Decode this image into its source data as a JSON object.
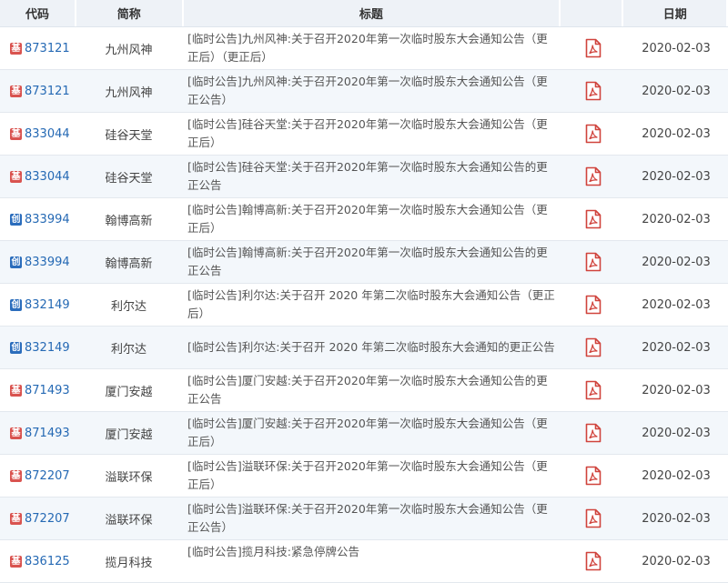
{
  "header": {
    "code": "代码",
    "name": "简称",
    "title": "标题",
    "pdf": "",
    "date": "日期"
  },
  "colors": {
    "badge_ji": "#d9534f",
    "badge_chuang": "#2b6dbc",
    "link": "#2569b4",
    "pdf_red": "#d0433c"
  },
  "pdf_icon": "pdf-file-icon",
  "rows": [
    {
      "badge": "基",
      "badge_type": "ji",
      "code": "873121",
      "name": "九州风神",
      "title": "[临时公告]九州风神:关于召开2020年第一次临时股东大会通知公告（更正后）（更正后）",
      "date": "2020-02-03"
    },
    {
      "badge": "基",
      "badge_type": "ji",
      "code": "873121",
      "name": "九州风神",
      "title": "[临时公告]九州风神:关于召开2020年第一次临时股东大会通知公告（更正公告）",
      "date": "2020-02-03"
    },
    {
      "badge": "基",
      "badge_type": "ji",
      "code": "833044",
      "name": "硅谷天堂",
      "title": "[临时公告]硅谷天堂:关于召开2020年第一次临时股东大会通知公告（更正后）",
      "date": "2020-02-03"
    },
    {
      "badge": "基",
      "badge_type": "ji",
      "code": "833044",
      "name": "硅谷天堂",
      "title": "[临时公告]硅谷天堂:关于召开2020年第一次临时股东大会通知公告的更正公告",
      "date": "2020-02-03"
    },
    {
      "badge": "创",
      "badge_type": "chuang",
      "code": "833994",
      "name": "翰博高新",
      "title": "[临时公告]翰博高新:关于召开2020年第一次临时股东大会通知公告（更正后）",
      "date": "2020-02-03"
    },
    {
      "badge": "创",
      "badge_type": "chuang",
      "code": "833994",
      "name": "翰博高新",
      "title": "[临时公告]翰博高新:关于召开2020年第一次临时股东大会通知公告的更正公告",
      "date": "2020-02-03"
    },
    {
      "badge": "创",
      "badge_type": "chuang",
      "code": "832149",
      "name": "利尔达",
      "title": "[临时公告]利尔达:关于召开 2020 年第二次临时股东大会通知公告（更正后）",
      "date": "2020-02-03"
    },
    {
      "badge": "创",
      "badge_type": "chuang",
      "code": "832149",
      "name": "利尔达",
      "title": "[临时公告]利尔达:关于召开 2020 年第二次临时股东大会通知的更正公告",
      "date": "2020-02-03"
    },
    {
      "badge": "基",
      "badge_type": "ji",
      "code": "871493",
      "name": "厦门安越",
      "title": "[临时公告]厦门安越:关于召开2020年第一次临时股东大会通知公告的更正公告",
      "date": "2020-02-03"
    },
    {
      "badge": "基",
      "badge_type": "ji",
      "code": "871493",
      "name": "厦门安越",
      "title": "[临时公告]厦门安越:关于召开2020年第一次临时股东大会通知公告（更正后）",
      "date": "2020-02-03"
    },
    {
      "badge": "基",
      "badge_type": "ji",
      "code": "872207",
      "name": "溢联环保",
      "title": "[临时公告]溢联环保:关于召开2020年第一次临时股东大会通知公告（更正后）",
      "date": "2020-02-03"
    },
    {
      "badge": "基",
      "badge_type": "ji",
      "code": "872207",
      "name": "溢联环保",
      "title": "[临时公告]溢联环保:关于召开2020年第一次临时股东大会通知公告（更正公告）",
      "date": "2020-02-03"
    },
    {
      "badge": "基",
      "badge_type": "ji",
      "code": "836125",
      "name": "揽月科技",
      "title": "[临时公告]揽月科技:紧急停牌公告",
      "date": "2020-02-03"
    }
  ]
}
